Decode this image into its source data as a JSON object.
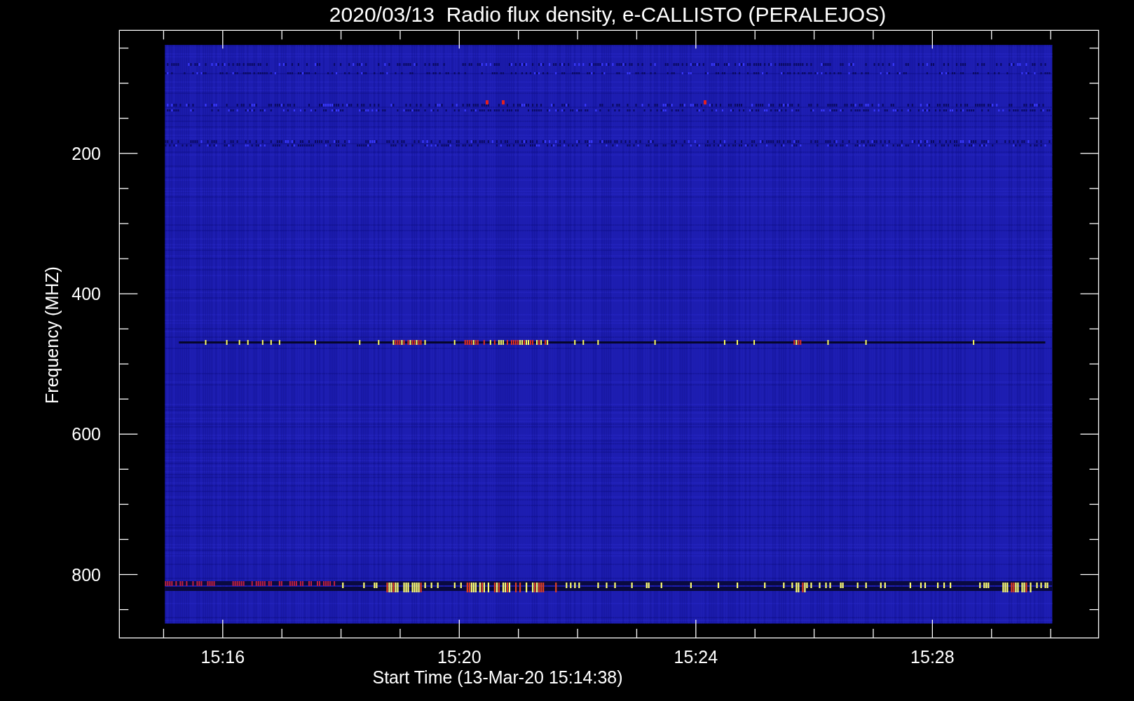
{
  "title": "2020/03/13  Radio flux density, e-CALLISTO (PERALEJOS)",
  "plot": {
    "ylabel": "Frequency (MHZ)",
    "xlabel": "Start Time (13-Mar-20 15:14:38)",
    "y_ticks": [
      "200",
      "400",
      "600",
      "800"
    ],
    "x_ticks": [
      "15:16",
      "15:20",
      "15:24",
      "15:28"
    ]
  }
}
